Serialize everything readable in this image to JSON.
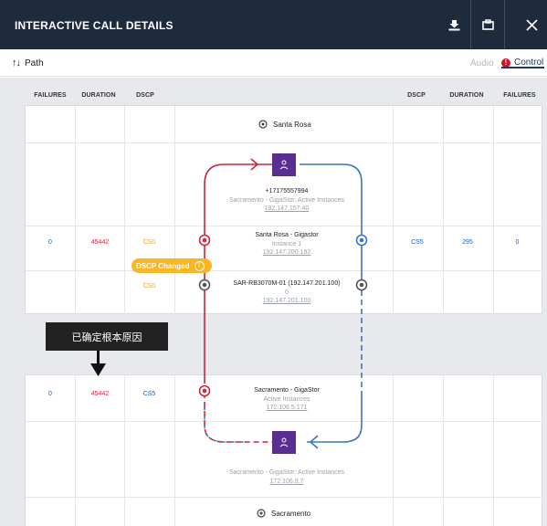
{
  "header": {
    "title": "INTERACTIVE CALL DETAILS"
  },
  "subbar": {
    "path_label": "Path",
    "audio_tab": "Audio",
    "control_tab": "Control",
    "alert_mark": "!"
  },
  "columns": {
    "left": [
      "FAILURES",
      "DURATION",
      "DSCP"
    ],
    "right": [
      "DSCP",
      "DURATION",
      "FAILURES"
    ]
  },
  "top_card": {
    "location": "Santa Rosa",
    "endpoint": {
      "number": "+17175557994",
      "label": "Sacramento - GigaStor: Active Instances",
      "ip": "192.147.157.40"
    },
    "hop1": {
      "name": "Santa Rosa - Gigastor",
      "sub": "Instance 1",
      "ip": "192.147.200.192",
      "left": {
        "failures": "0",
        "duration": "45442",
        "dscp": "CS0"
      },
      "right": {
        "dscp": "CS5",
        "duration": "295",
        "failures": "0"
      }
    },
    "hop2": {
      "name": "SAR-RB3070M-01 (192.147.201.100)",
      "sub": "0",
      "ip": "192.147.201.100",
      "left": {
        "dscp": "CS0"
      }
    }
  },
  "badge": {
    "label": "DSCP Changed"
  },
  "callout": {
    "text": "已确定根本原因"
  },
  "bottom_card": {
    "hop1": {
      "name": "Sacramento - GigaStor",
      "sub": "Active Instances",
      "ip": "172.106.5.171",
      "left": {
        "failures": "0",
        "duration": "45442",
        "dscp": "CS5"
      }
    },
    "endpoint": {
      "label": "Sacramento - GigaStor: Active Instances",
      "ip": "172.106.9.7"
    },
    "location": "Sacramento"
  },
  "colors": {
    "header_bg": "#1d2b3d",
    "path_red": "#d1263a",
    "path_blue": "#3b74c4",
    "endpoint_purple": "#5b2d90",
    "badge": "#f9b523"
  }
}
